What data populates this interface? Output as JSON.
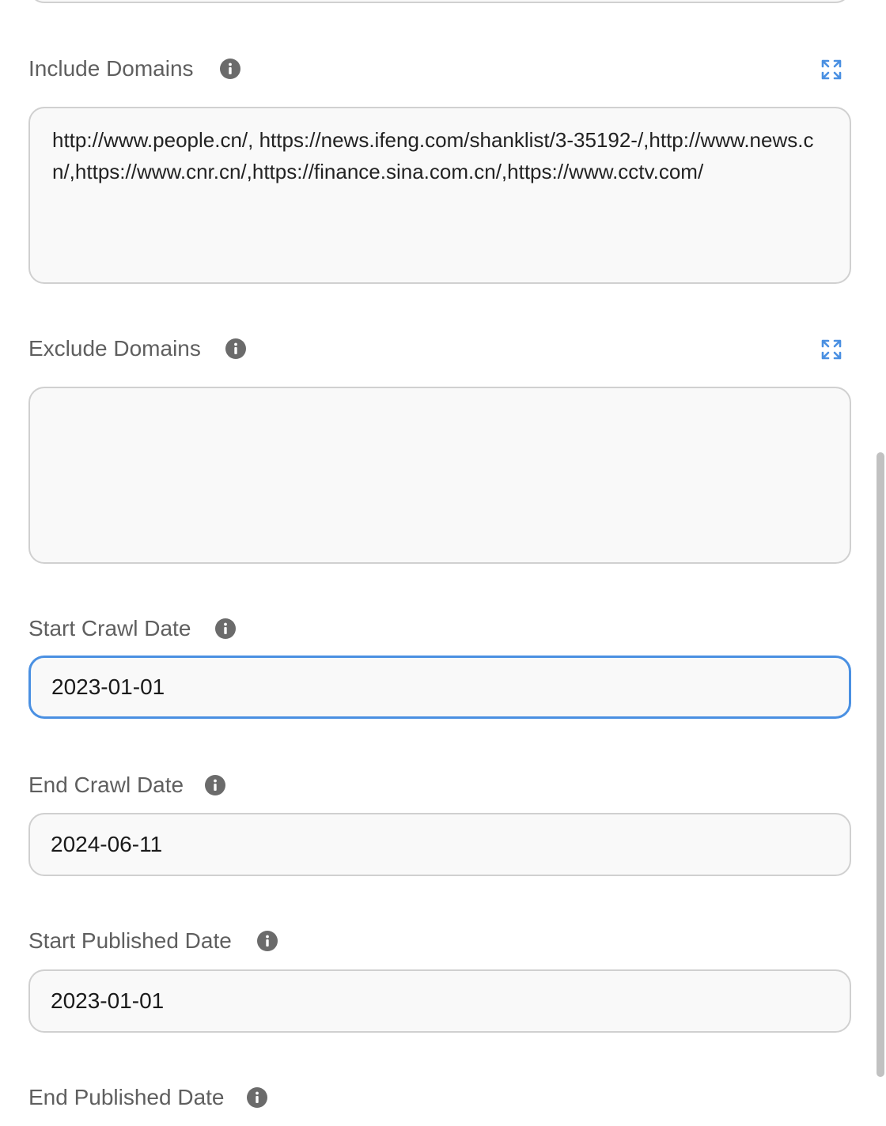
{
  "fields": {
    "include_domains": {
      "label": "Include Domains",
      "value": "http://www.people.cn/, https://news.ifeng.com/shanklist/3-35192-/,http://www.news.cn/,https://www.cnr.cn/,https://finance.sina.com.cn/,https://www.cctv.com/"
    },
    "exclude_domains": {
      "label": "Exclude Domains",
      "value": ""
    },
    "start_crawl_date": {
      "label": "Start Crawl Date",
      "value": "2023-01-01"
    },
    "end_crawl_date": {
      "label": "End Crawl Date",
      "value": "2024-06-11"
    },
    "start_published_date": {
      "label": "Start Published Date",
      "value": "2023-01-01"
    },
    "end_published_date": {
      "label": "End Published Date"
    }
  },
  "icons": {
    "info": "info-icon",
    "expand": "expand-icon"
  },
  "colors": {
    "focus_border": "#4a90e2",
    "expand_icon": "#4a90e2",
    "info_icon": "#6b6b6b",
    "label": "#5f5f5f"
  }
}
